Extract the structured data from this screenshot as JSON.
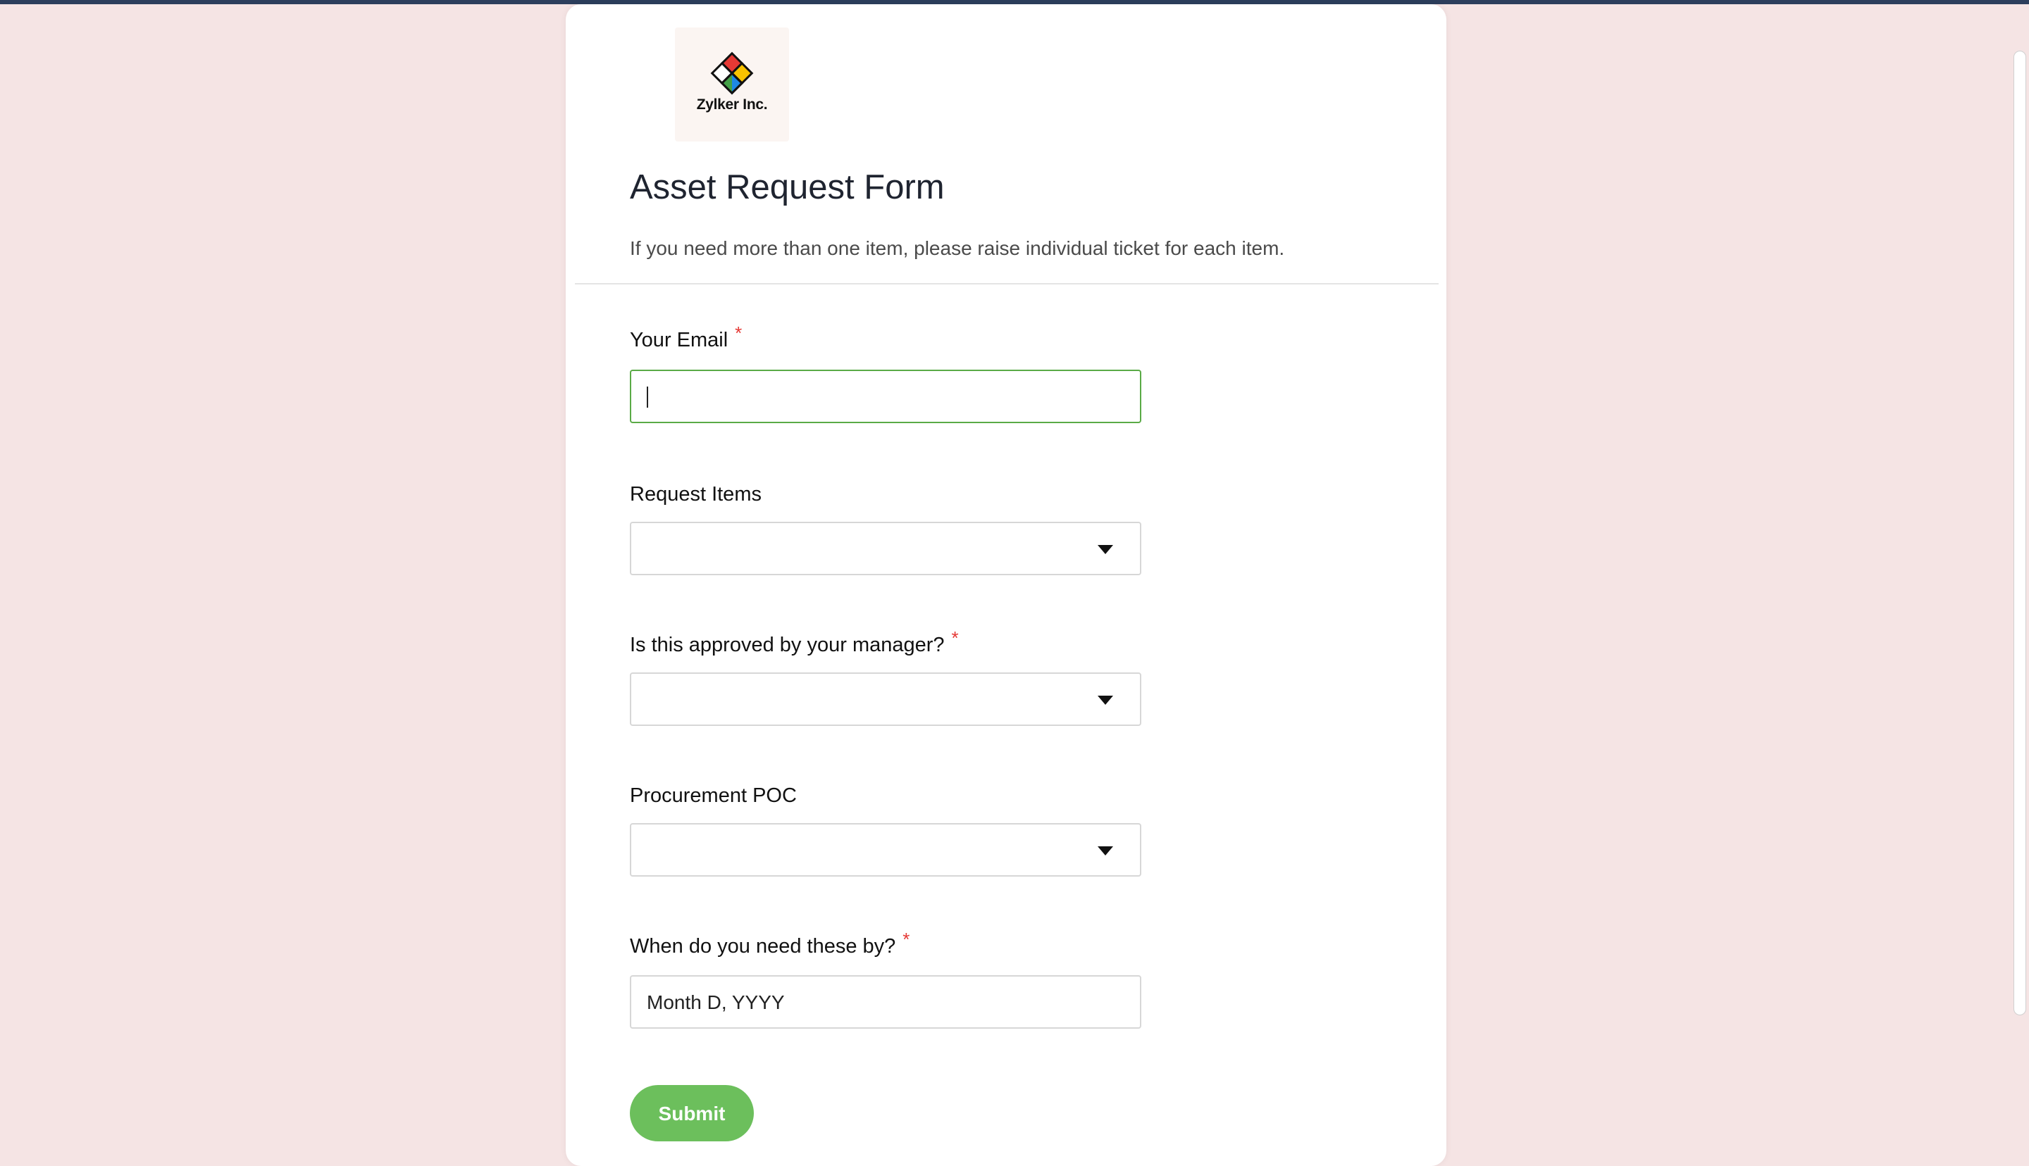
{
  "brand": {
    "logo_text": "Zylker Inc.",
    "accent_color": "#5aaa46",
    "button_color": "#6cbf5c",
    "required_color": "#e53935"
  },
  "form": {
    "title": "Asset Request Form",
    "description": "If you need more than one item, please raise individual ticket for each item.",
    "required_mark": "*",
    "fields": {
      "email": {
        "label": "Your Email",
        "value": ""
      },
      "request_items": {
        "label": "Request Items",
        "value": ""
      },
      "manager_approved": {
        "label": "Is this approved by your manager?",
        "value": ""
      },
      "procurement_poc": {
        "label": "Procurement POC",
        "value": ""
      },
      "need_by": {
        "label": "When do you need these by?",
        "placeholder": "Month D, YYYY"
      }
    },
    "submit_label": "Submit"
  },
  "icons": {
    "dropdown": "chevron-down-icon",
    "logo": "zylker-logo-icon"
  }
}
